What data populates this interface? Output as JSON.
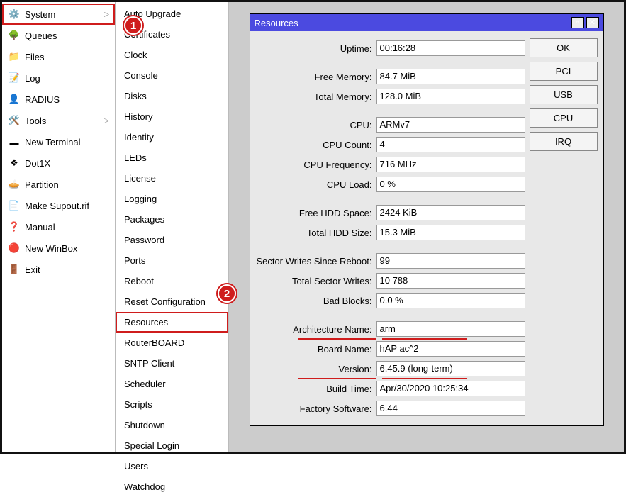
{
  "main_menu": {
    "items": [
      {
        "label": "System",
        "icon": "gear-icon",
        "submenu": true,
        "hl": true
      },
      {
        "label": "Queues",
        "icon": "queues-icon"
      },
      {
        "label": "Files",
        "icon": "files-icon"
      },
      {
        "label": "Log",
        "icon": "log-icon"
      },
      {
        "label": "RADIUS",
        "icon": "radius-icon"
      },
      {
        "label": "Tools",
        "icon": "tools-icon",
        "submenu": true
      },
      {
        "label": "New Terminal",
        "icon": "terminal-icon"
      },
      {
        "label": "Dot1X",
        "icon": "dot1x-icon"
      },
      {
        "label": "Partition",
        "icon": "partition-icon"
      },
      {
        "label": "Make Supout.rif",
        "icon": "supout-icon"
      },
      {
        "label": "Manual",
        "icon": "manual-icon"
      },
      {
        "label": "New WinBox",
        "icon": "winbox-icon"
      },
      {
        "label": "Exit",
        "icon": "exit-icon"
      }
    ]
  },
  "sub_menu": {
    "items": [
      {
        "label": "Auto Upgrade"
      },
      {
        "label": "Certificates"
      },
      {
        "label": "Clock"
      },
      {
        "label": "Console"
      },
      {
        "label": "Disks"
      },
      {
        "label": "History"
      },
      {
        "label": "Identity"
      },
      {
        "label": "LEDs"
      },
      {
        "label": "License"
      },
      {
        "label": "Logging"
      },
      {
        "label": "Packages"
      },
      {
        "label": "Password"
      },
      {
        "label": "Ports"
      },
      {
        "label": "Reboot"
      },
      {
        "label": "Reset Configuration"
      },
      {
        "label": "Resources",
        "hl": true
      },
      {
        "label": "RouterBOARD"
      },
      {
        "label": "SNTP Client"
      },
      {
        "label": "Scheduler"
      },
      {
        "label": "Scripts"
      },
      {
        "label": "Shutdown"
      },
      {
        "label": "Special Login"
      },
      {
        "label": "Users"
      },
      {
        "label": "Watchdog"
      }
    ]
  },
  "badges": {
    "b1": "1",
    "b2": "2"
  },
  "dialog": {
    "title": "Resources",
    "groups": [
      [
        {
          "label": "Uptime:",
          "value": "00:16:28"
        }
      ],
      [
        {
          "label": "Free Memory:",
          "value": "84.7 MiB"
        },
        {
          "label": "Total Memory:",
          "value": "128.0 MiB"
        }
      ],
      [
        {
          "label": "CPU:",
          "value": "ARMv7"
        },
        {
          "label": "CPU Count:",
          "value": "4"
        },
        {
          "label": "CPU Frequency:",
          "value": "716 MHz"
        },
        {
          "label": "CPU Load:",
          "value": "0 %"
        }
      ],
      [
        {
          "label": "Free HDD Space:",
          "value": "2424 KiB"
        },
        {
          "label": "Total HDD Size:",
          "value": "15.3 MiB"
        }
      ],
      [
        {
          "label": "Sector Writes Since Reboot:",
          "value": "99"
        },
        {
          "label": "Total Sector Writes:",
          "value": "10 788"
        },
        {
          "label": "Bad Blocks:",
          "value": "0.0 %"
        }
      ],
      [
        {
          "label": "Architecture Name:",
          "value": "arm",
          "red": true
        },
        {
          "label": "Board Name:",
          "value": "hAP ac^2"
        },
        {
          "label": "Version:",
          "value": "6.45.9 (long-term)",
          "red": true
        },
        {
          "label": "Build Time:",
          "value": "Apr/30/2020 10:25:34"
        },
        {
          "label": "Factory Software:",
          "value": "6.44"
        }
      ]
    ],
    "buttons": [
      "OK",
      "PCI",
      "USB",
      "CPU",
      "IRQ"
    ]
  },
  "icons": {
    "gear-icon": "⚙️",
    "queues-icon": "🌳",
    "files-icon": "📁",
    "log-icon": "📝",
    "radius-icon": "👤",
    "tools-icon": "🛠️",
    "terminal-icon": "▬",
    "dot1x-icon": "❖",
    "partition-icon": "🥧",
    "supout-icon": "📄",
    "manual-icon": "❓",
    "winbox-icon": "🔴",
    "exit-icon": "🚪"
  }
}
